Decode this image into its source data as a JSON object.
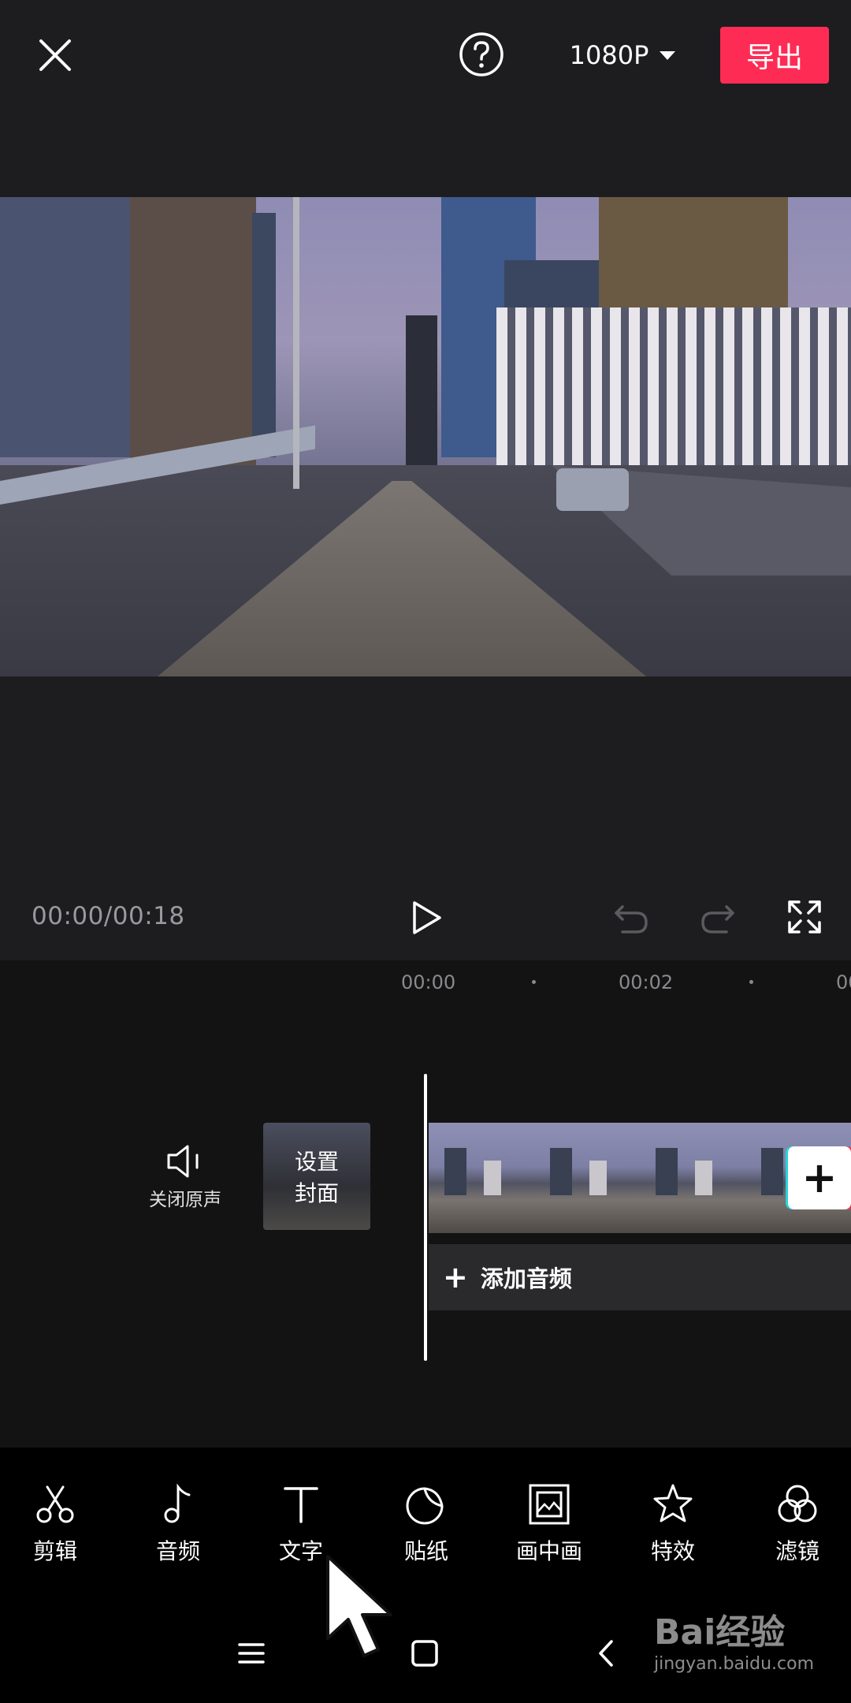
{
  "header": {
    "resolution": "1080P",
    "export_label": "导出"
  },
  "player": {
    "timecode": "00:00/00:18"
  },
  "timeline": {
    "ruler": [
      "00:00",
      "00:02",
      "00"
    ],
    "mute_label": "关闭原声",
    "cover_label_line1": "设置",
    "cover_label_line2": "封面",
    "add_audio_label": "添加音频"
  },
  "toolbar": {
    "items": [
      {
        "label": "剪辑",
        "icon": "scissors-icon"
      },
      {
        "label": "音频",
        "icon": "music-note-icon"
      },
      {
        "label": "文字",
        "icon": "text-icon"
      },
      {
        "label": "贴纸",
        "icon": "sticker-icon"
      },
      {
        "label": "画中画",
        "icon": "picture-in-picture-icon"
      },
      {
        "label": "特效",
        "icon": "star-effect-icon"
      },
      {
        "label": "滤镜",
        "icon": "filter-icon"
      }
    ]
  },
  "watermark": {
    "logo": "Bai经验",
    "url": "jingyan.baidu.com"
  },
  "colors": {
    "accent": "#fe2c55",
    "background": "#1d1d1f",
    "timeline_bg": "#131313",
    "toolbar_bg": "#000000"
  }
}
